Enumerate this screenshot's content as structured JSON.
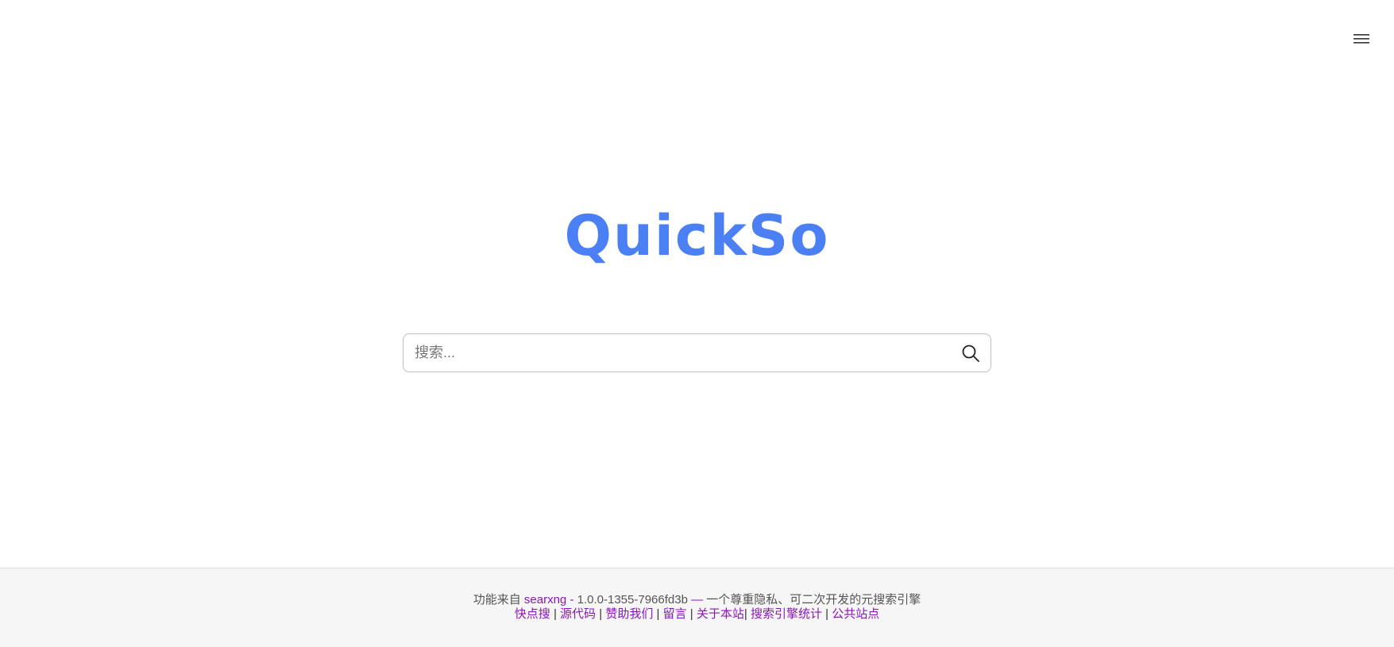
{
  "header": {
    "menu_icon": "hamburger-menu-icon"
  },
  "logo": {
    "text": "QuickSo",
    "color": "#4b80f4"
  },
  "search": {
    "placeholder": "搜索...",
    "value": "",
    "button_icon": "magnifier-search-icon"
  },
  "footer": {
    "powered_prefix": "功能来自",
    "searxng_link": "searxng",
    "dash": "-",
    "version": "1.0.0-1355-7966fd3b",
    "em_dash": "—",
    "tagline": "一个尊重隐私、可二次开发的元搜索引擎",
    "links": [
      {
        "label": "快点搜"
      },
      {
        "label": "源代码"
      },
      {
        "label": "赞助我们"
      },
      {
        "label": "留言"
      },
      {
        "label": "关于本站"
      },
      {
        "label": "搜索引擎统计"
      },
      {
        "label": "公共站点"
      }
    ],
    "separator": "|",
    "link_color": "#8a16b8"
  }
}
